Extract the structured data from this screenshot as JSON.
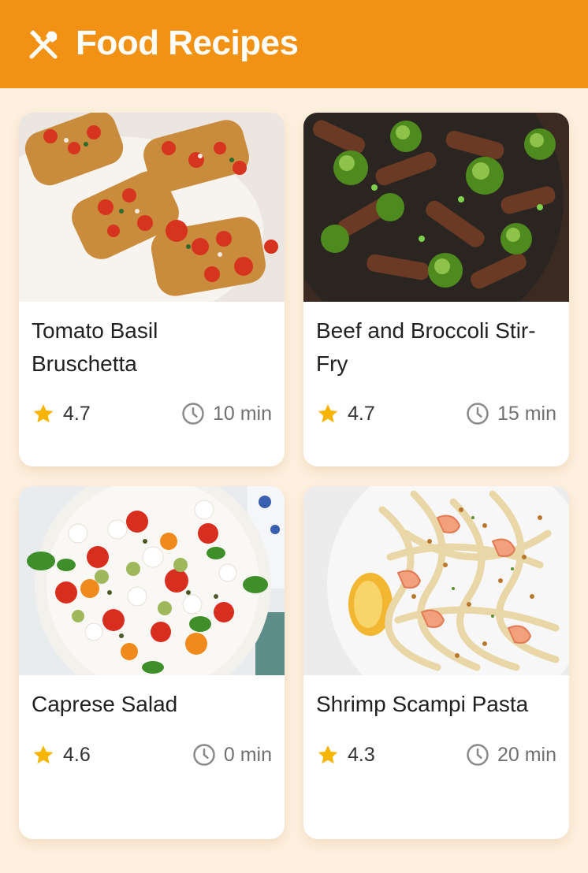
{
  "app": {
    "title": "Food Recipes",
    "icon": "fork-knife-icon",
    "accent_color": "#F29214",
    "background_color": "#FDF0DF"
  },
  "recipes": [
    {
      "title": "Tomato Basil Bruschetta",
      "rating": "4.7",
      "time": "10 min",
      "image": "bruschetta-photo"
    },
    {
      "title": "Beef and Broccoli Stir-Fry",
      "rating": "4.7",
      "time": "15 min",
      "image": "beef-broccoli-photo"
    },
    {
      "title": "Caprese Salad",
      "rating": "4.6",
      "time": "0 min",
      "image": "caprese-salad-photo"
    },
    {
      "title": "Shrimp Scampi Pasta",
      "rating": "4.3",
      "time": "20 min",
      "image": "shrimp-scampi-photo"
    }
  ],
  "icons": {
    "rating": "star-icon",
    "time": "clock-icon",
    "star_color": "#F7B500"
  }
}
